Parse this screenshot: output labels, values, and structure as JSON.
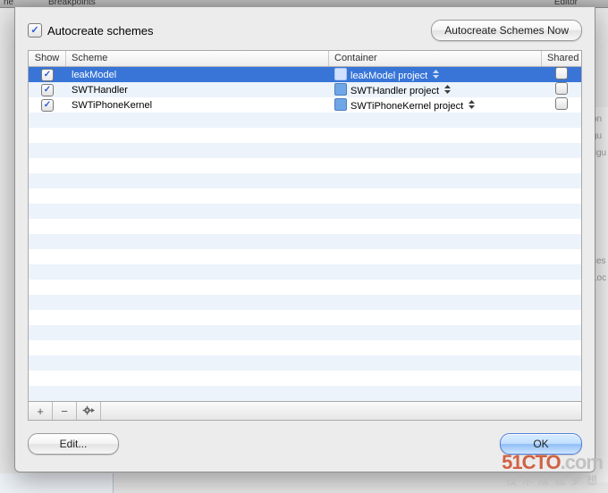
{
  "background": {
    "tab_left": "ne",
    "tab_mid": "Breakpoints",
    "tab_right": "Editor",
    "right_hints": [
      "on",
      "gu",
      "tigu",
      "ces",
      "Loc"
    ]
  },
  "header": {
    "autocreate_label": "Autocreate schemes",
    "autocreate_checked": true,
    "button_label": "Autocreate Schemes Now"
  },
  "columns": {
    "show": "Show",
    "scheme": "Scheme",
    "container": "Container",
    "shared": "Shared"
  },
  "rows": [
    {
      "show": true,
      "scheme": "leakModel",
      "container": "leakModel project",
      "shared": false,
      "selected": true
    },
    {
      "show": true,
      "scheme": "SWTHandler",
      "container": "SWTHandler project",
      "shared": false,
      "selected": false
    },
    {
      "show": true,
      "scheme": "SWTiPhoneKernel",
      "container": "SWTiPhoneKernel project",
      "shared": false,
      "selected": false
    }
  ],
  "empty_row_count": 19,
  "controls": {
    "add": "+",
    "remove": "−",
    "gear": "gear"
  },
  "footer": {
    "edit": "Edit...",
    "ok": "OK"
  },
  "watermark": {
    "logo_main": "51CTO",
    "logo_suffix": ".com",
    "subtitle": "技术成就梦想"
  }
}
